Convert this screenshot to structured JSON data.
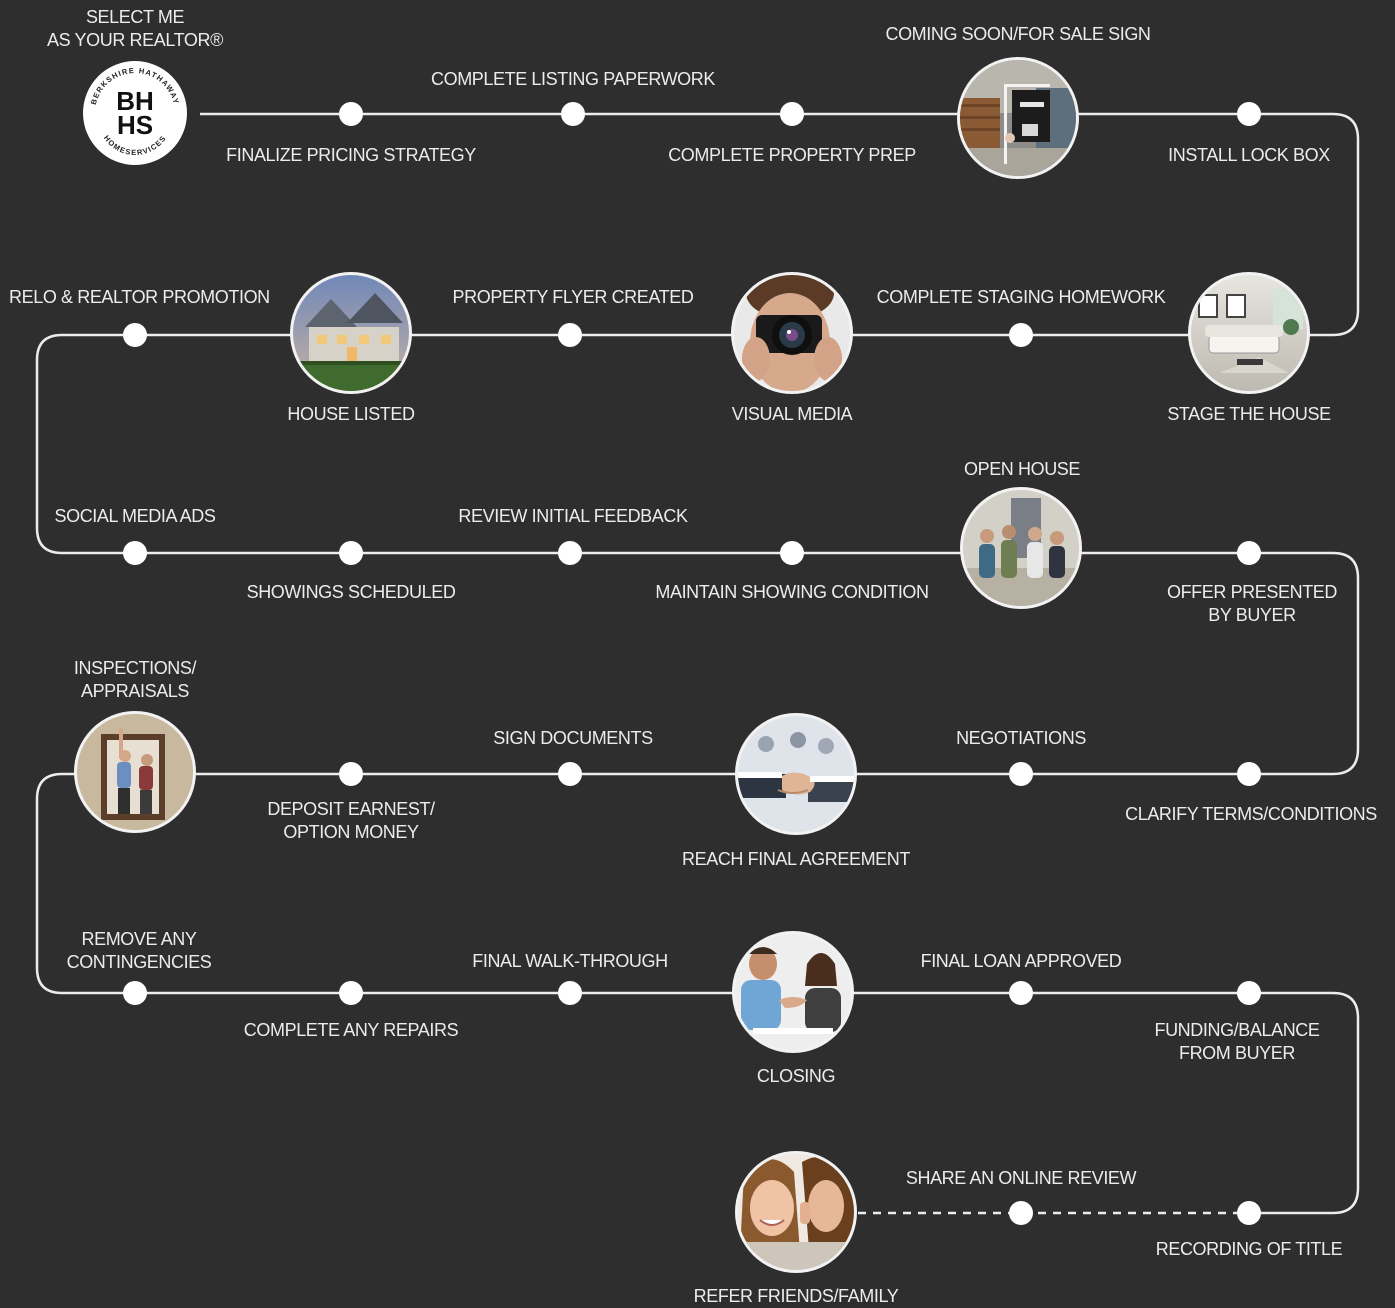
{
  "header": {
    "select_line1": "SELECT ME",
    "select_line2": "AS YOUR REALTOR®"
  },
  "logo": {
    "monogram_top": "BH",
    "monogram_bottom": "HS",
    "ring_top": "BERKSHIRE HATHAWAY",
    "ring_bottom": "HOMESERVICES"
  },
  "steps": {
    "finalize_pricing": "FINALIZE PRICING STRATEGY",
    "listing_paperwork": "COMPLETE LISTING PAPERWORK",
    "property_prep": "COMPLETE PROPERTY PREP",
    "sale_sign": "COMING SOON/FOR SALE SIGN",
    "lock_box": "INSTALL LOCK BOX",
    "stage_house": "STAGE THE HOUSE",
    "staging_homework": "COMPLETE STAGING HOMEWORK",
    "visual_media": "VISUAL MEDIA",
    "flyer_created": "PROPERTY FLYER CREATED",
    "house_listed": "HOUSE LISTED",
    "relo_promotion": "RELO & REALTOR PROMOTION",
    "social_ads": "SOCIAL MEDIA ADS",
    "showings_scheduled": "SHOWINGS SCHEDULED",
    "initial_feedback": "REVIEW INITIAL FEEDBACK",
    "showing_condition": "MAINTAIN SHOWING CONDITION",
    "open_house": "OPEN HOUSE",
    "offer_line1": "OFFER PRESENTED",
    "offer_line2": "BY BUYER",
    "clarify_terms": "CLARIFY TERMS/CONDITIONS",
    "negotiations": "NEGOTIATIONS",
    "final_agreement": "REACH FINAL AGREEMENT",
    "sign_documents": "SIGN DOCUMENTS",
    "deposit_line1": "DEPOSIT EARNEST/",
    "deposit_line2": "OPTION MONEY",
    "inspections_line1": "INSPECTIONS/",
    "inspections_line2": "APPRAISALS",
    "contingencies_line1": "REMOVE ANY",
    "contingencies_line2": "CONTINGENCIES",
    "repairs": "COMPLETE ANY REPAIRS",
    "walk_through": "FINAL WALK-THROUGH",
    "closing": "CLOSING",
    "loan_approved": "FINAL LOAN APPROVED",
    "funding_line1": "FUNDING/BALANCE",
    "funding_line2": "FROM BUYER",
    "recording_title": "RECORDING OF TITLE",
    "online_review": "SHARE AN ONLINE REVIEW",
    "refer_friends": "REFER FRIENDS/FAMILY"
  },
  "photos": {
    "sale_sign": "sign-photo",
    "stage_house": "living-room-photo",
    "visual_media": "camera-photo",
    "house_listed": "house-photo",
    "open_house": "open-house-photo",
    "final_agreement": "handshake-photo",
    "inspections": "inspection-photo",
    "closing": "closing-photo",
    "refer_friends": "friends-whisper-photo"
  },
  "colors": {
    "background": "#2e2e2e",
    "path": "#ececec",
    "text": "#ececec"
  }
}
